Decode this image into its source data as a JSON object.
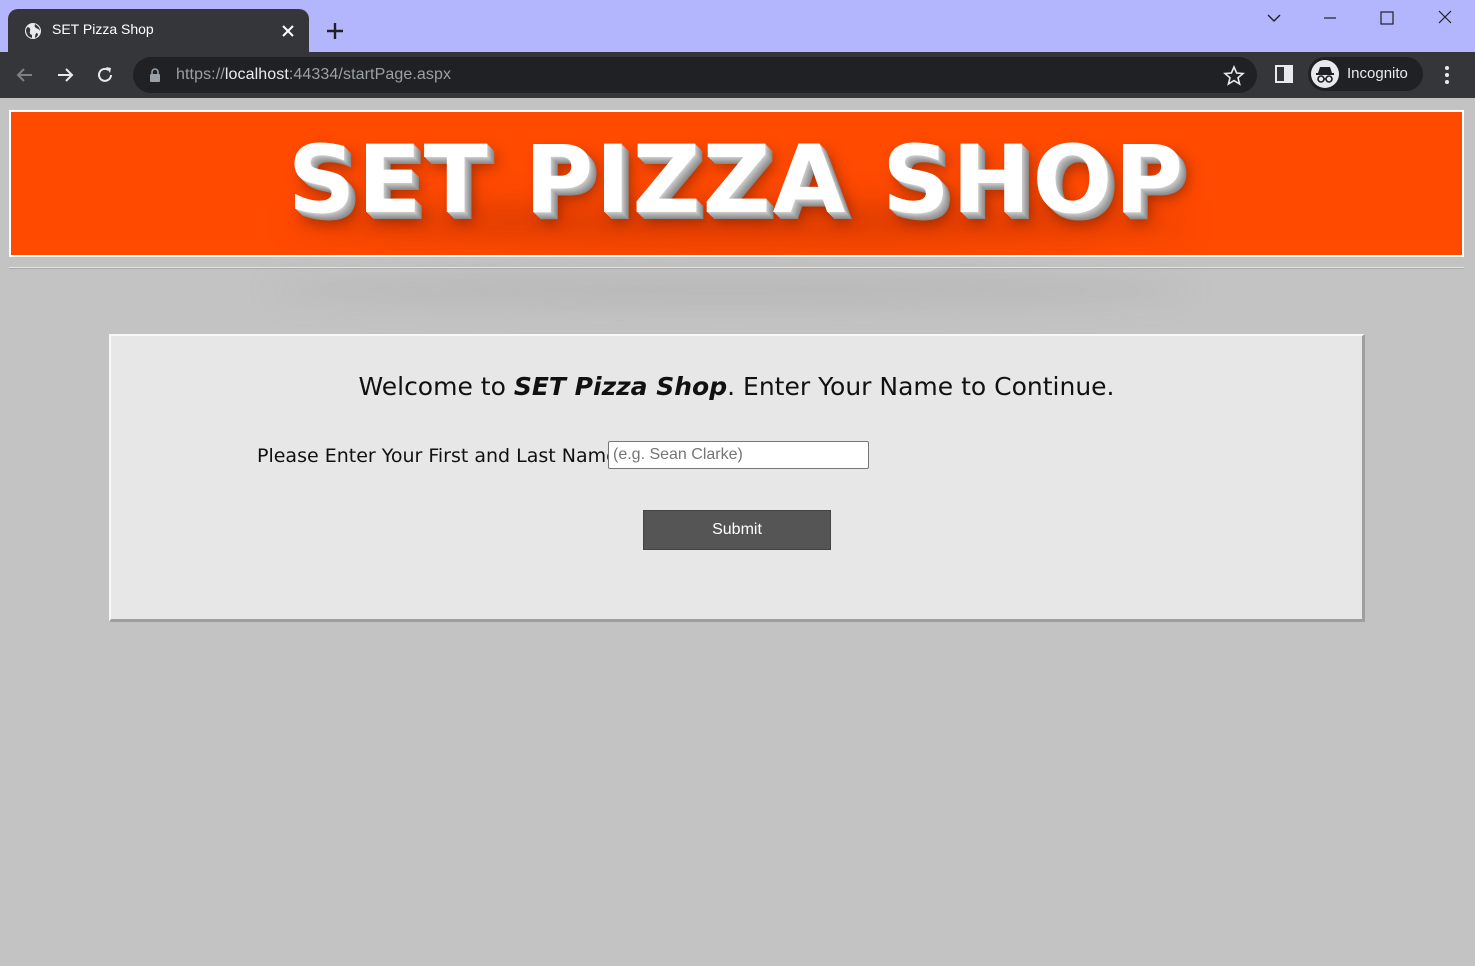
{
  "browser": {
    "tab_title": "SET Pizza Shop",
    "url_scheme": "https://",
    "url_host": "localhost",
    "url_rest": ":44334/startPage.aspx",
    "profile_label": "Incognito",
    "titlebar_color": "#b3b5fd",
    "toolbar_color": "#35363a"
  },
  "header": {
    "title": "SET PIZZA SHOP",
    "background_color": "#ff4a00"
  },
  "form": {
    "welcome_prefix": "Welcome to ",
    "welcome_brand": "SET Pizza Shop",
    "welcome_suffix": ". Enter Your Name to Continue.",
    "name_label": "Please Enter Your First and Last Name",
    "name_placeholder": "(e.g. Sean Clarke)",
    "name_value": "",
    "submit_label": "Submit"
  },
  "icons": {
    "tab": "globe-icon",
    "close_tab": "close-icon",
    "new_tab": "plus-icon",
    "back": "arrow-left-icon",
    "forward": "arrow-right-icon",
    "reload": "reload-icon",
    "lock": "lock-icon",
    "bookmark": "star-icon",
    "side_panel": "side-panel-icon",
    "incognito": "incognito-icon",
    "menu": "kebab-menu-icon"
  }
}
